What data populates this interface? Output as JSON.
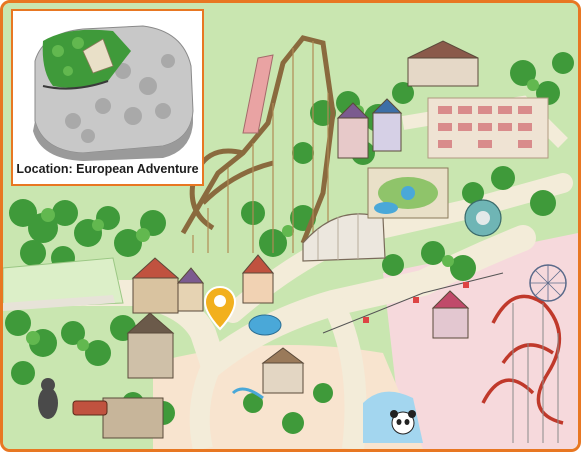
{
  "inset": {
    "location_label": "Location: European Adventure"
  },
  "colors": {
    "frame_accent": "#e87722",
    "grass": "#c9e6b0",
    "forest": "#3f9a3a",
    "path": "#f3ecd9",
    "pink_zone": "#f6d9dc",
    "water": "#4aa8d8",
    "coaster_wood": "#8a6a3e",
    "marker": "#f2b01e"
  },
  "icons": {
    "marker": "location-pin-icon",
    "mascot": "panda-mascot-icon"
  }
}
